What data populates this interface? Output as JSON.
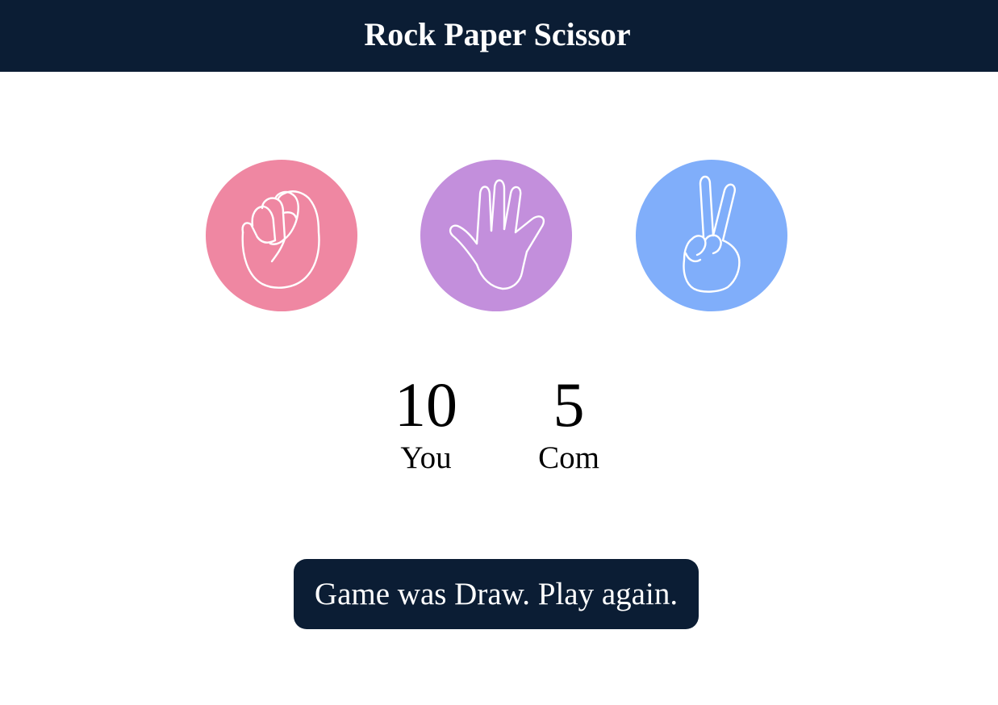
{
  "header": {
    "title": "Rock Paper Scissor"
  },
  "choices": [
    {
      "id": "rock",
      "icon": "fist-icon",
      "color": "#ef87a2"
    },
    {
      "id": "paper",
      "icon": "open-hand-icon",
      "color": "#c38fdc"
    },
    {
      "id": "scissor",
      "icon": "peace-sign-icon",
      "color": "#80aefa"
    }
  ],
  "scoreboard": {
    "user": {
      "score": "10",
      "label": "You"
    },
    "computer": {
      "score": "5",
      "label": "Com"
    }
  },
  "message": {
    "text": "Game was Draw. Play again.",
    "color": "#0b1d34"
  }
}
